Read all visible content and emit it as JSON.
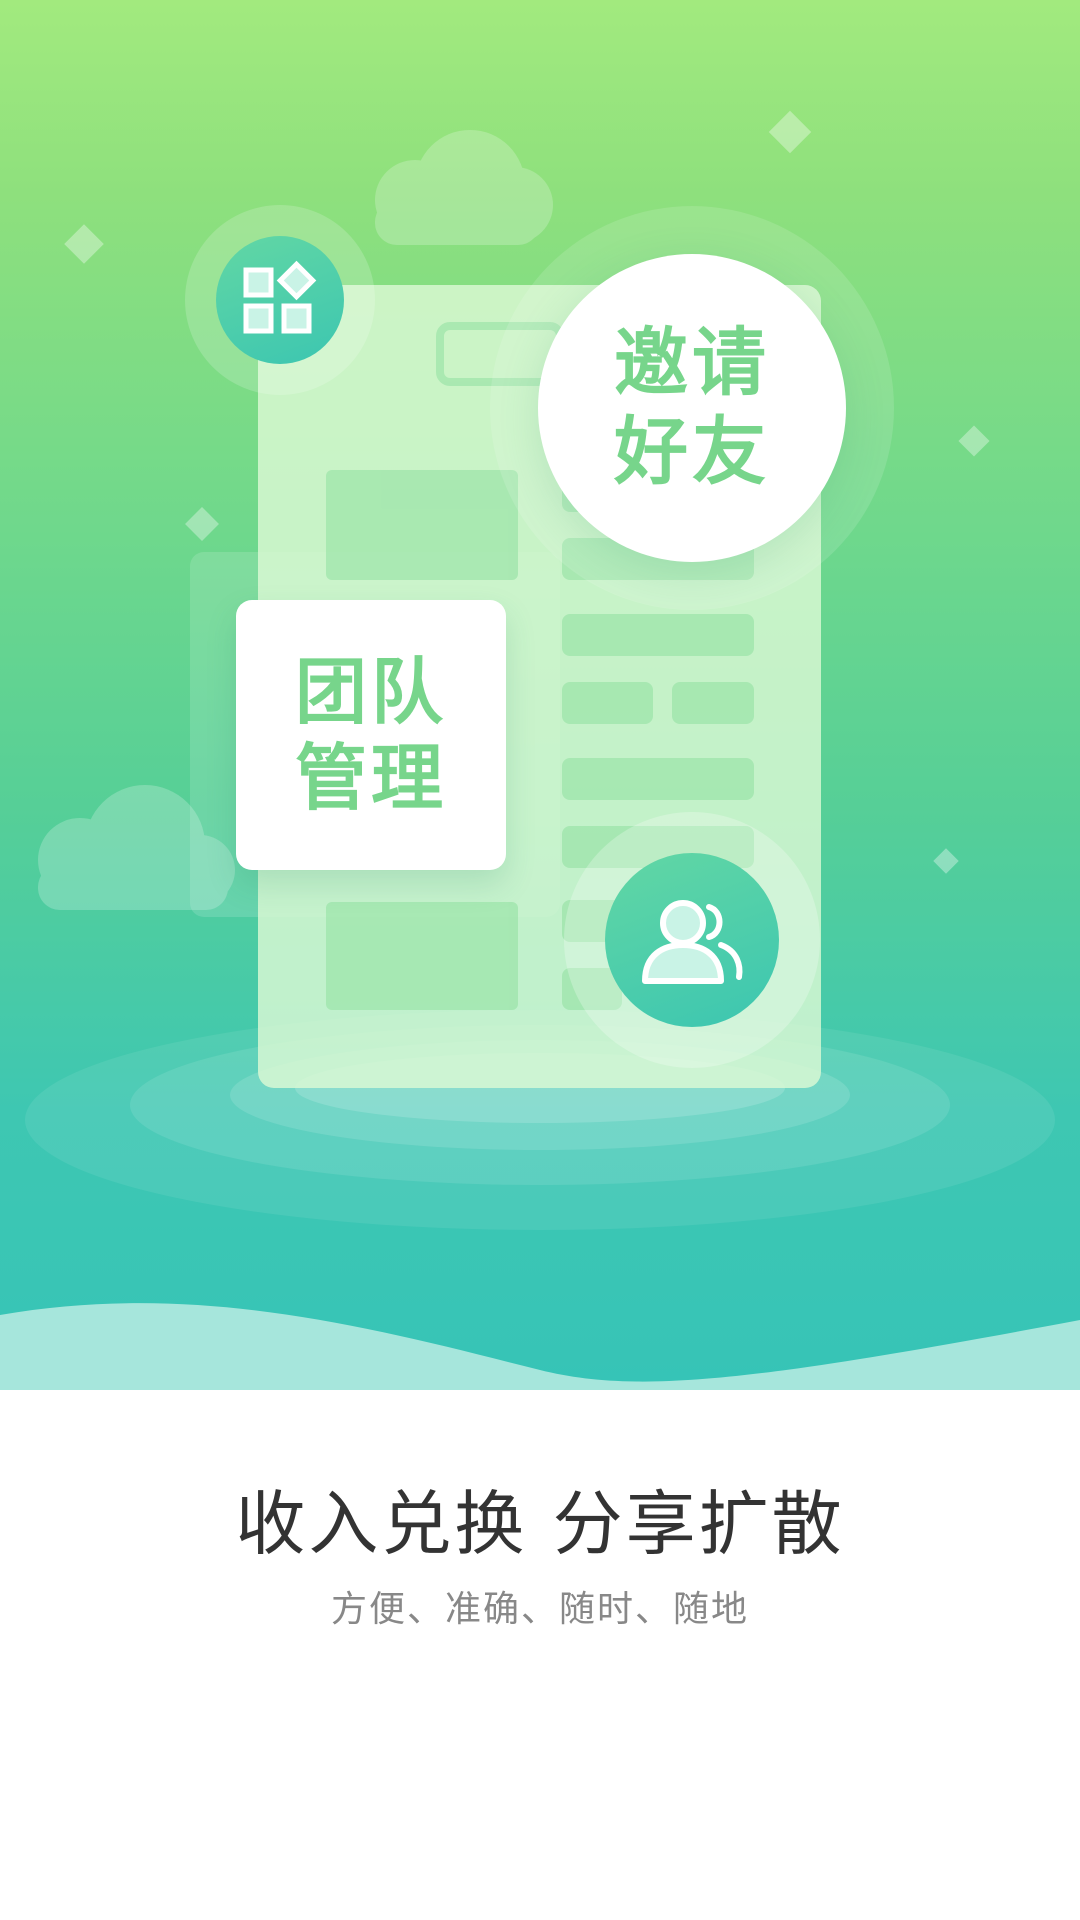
{
  "cards": {
    "invite_line1": "邀请",
    "invite_line2": "好友",
    "team_line1": "团队",
    "team_line2": "管理"
  },
  "icons": {
    "apps": "apps-grid-icon",
    "users": "users-icon"
  },
  "colors": {
    "hero_top": "#a2ea7e",
    "hero_bottom": "#36c4b7",
    "accent_text": "#77d58b",
    "headline": "#333333",
    "subline": "#888888"
  },
  "headline": "收入兑换 分享扩散",
  "subline": "方便、准确、随时、随地"
}
